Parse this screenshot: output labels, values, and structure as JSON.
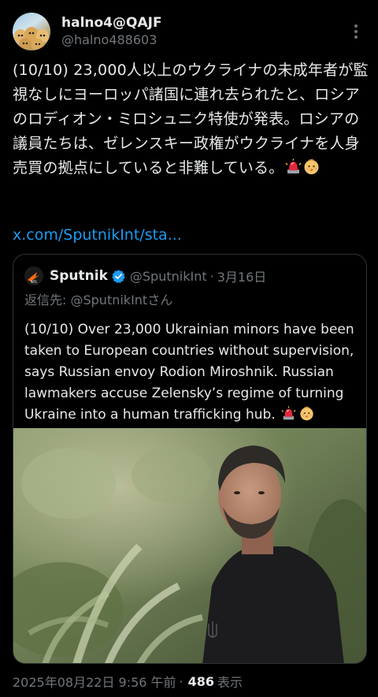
{
  "author": {
    "display_name": "halno4@QAJF",
    "handle": "@halno488603"
  },
  "post": {
    "text": "(10/10) 23,000人以上のウクライナの未成年者が監視なしにヨーロッパ諸国に連れ去られたと、ロシアのロディオン・ミロシュニク特使が発表。ロシアの議員たちは、ゼレンスキー政権がウクライナを人身売買の拠点にしていると非難している。",
    "link": "x.com/SputnikInt/sta..."
  },
  "quote": {
    "name": "Sputnik",
    "handle": "@SputnikInt",
    "dot": "·",
    "date": "3月16日",
    "reply_prefix": "返信先: ",
    "reply_mention": "@SputnikIntさん",
    "text": "(10/10) Over 23,000 Ukrainian minors have been taken to European countries without supervision, says Russian envoy Rodion Miroshnik. Russian lawmakers accuse Zelensky’s regime of turning Ukraine into a human trafficking hub."
  },
  "footer": {
    "timestamp": "2025年08月22日 9:56 午前",
    "sep": "·",
    "views": "486",
    "views_label": "表示"
  },
  "colors": {
    "background": "#000000",
    "text": "#e7e9ea",
    "muted": "#71767b",
    "link": "#1d9bf0",
    "border": "#2f3336"
  },
  "icons": {
    "more": "more-vertical-icon",
    "verified": "verified-badge-icon",
    "siren": "police-light-emoji",
    "baby": "baby-emoji"
  }
}
